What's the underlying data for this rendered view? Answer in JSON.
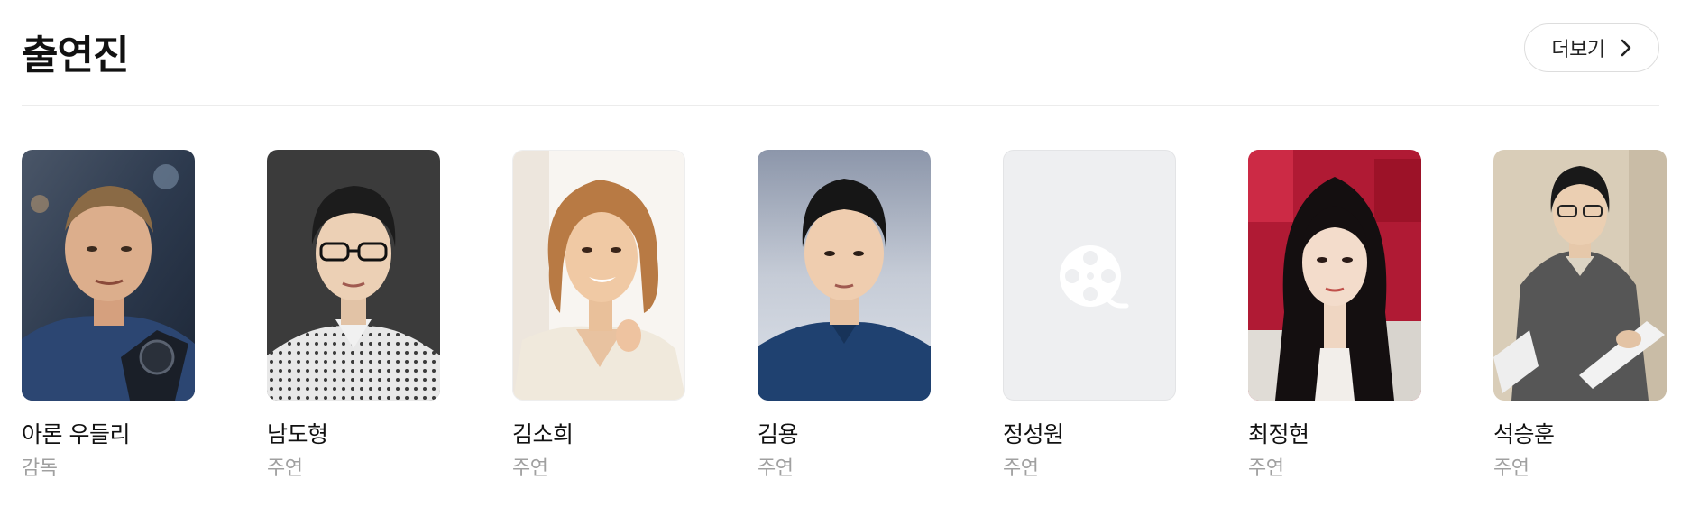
{
  "section": {
    "title": "출연진",
    "more_label": "더보기"
  },
  "cast": [
    {
      "name": "아론 우들리",
      "role": "감독",
      "photo": "person-photo"
    },
    {
      "name": "남도형",
      "role": "주연",
      "photo": "person-photo"
    },
    {
      "name": "김소희",
      "role": "주연",
      "photo": "person-photo"
    },
    {
      "name": "김용",
      "role": "주연",
      "photo": "person-photo"
    },
    {
      "name": "정성원",
      "role": "주연",
      "photo": "film-reel-placeholder-icon"
    },
    {
      "name": "최정현",
      "role": "주연",
      "photo": "person-photo"
    },
    {
      "name": "석승훈",
      "role": "주연",
      "photo": "person-photo"
    }
  ],
  "colors": {
    "title": "#111111",
    "role_text": "#a0a0a0",
    "divider": "#ececec",
    "placeholder_bg": "#eeeff1"
  }
}
